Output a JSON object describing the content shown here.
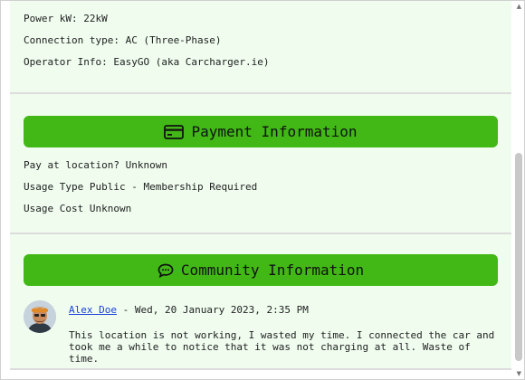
{
  "window": {
    "close_glyph": "×"
  },
  "charger": {
    "power_label": "Power kW: 22kW",
    "connection_label": "Connection type: AC (Three-Phase)",
    "operator_label": "Operator Info: EasyGO (aka Carcharger.ie)"
  },
  "payment": {
    "title": "Payment Information",
    "pay_at_location": "Pay at location? Unknown",
    "usage_type": "Usage Type Public - Membership Required",
    "usage_cost": "Usage Cost Unknown"
  },
  "community": {
    "title": "Community Information",
    "comments": [
      {
        "author": "Alex Doe",
        "date": " - Wed, 20 January 2023, 2:35 PM",
        "text": "This location is not working, I wasted my time. I connected the car and took me a while to notice that it was not charging at all. Waste of time."
      }
    ]
  },
  "colors": {
    "accent_green": "#41b816",
    "section_bg": "#effcee",
    "link_blue": "#1a3fd8"
  },
  "icons": {
    "payment": "credit-card-icon",
    "community": "chat-bubble-icon",
    "close": "close-icon"
  }
}
